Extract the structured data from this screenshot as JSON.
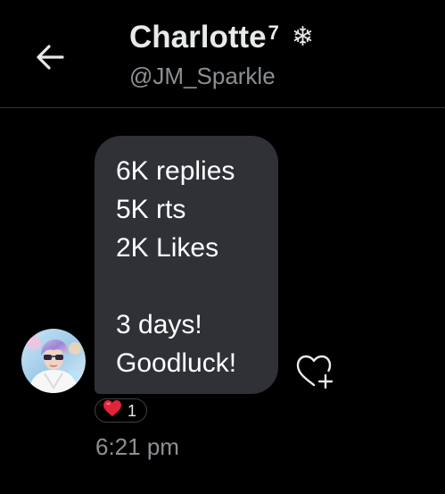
{
  "header": {
    "back_icon": "arrow-left-icon",
    "display_name": "Charlotte",
    "name_superscript": "7",
    "name_emoji": "❄",
    "handle": "@JM_Sparkle"
  },
  "message": {
    "lines": [
      "6K replies",
      "5K rts",
      "2K Likes",
      "3 days!",
      "Goodluck!"
    ],
    "reaction": {
      "icon": "heart-emoji-icon",
      "count": "1"
    },
    "add_reaction_icon": "heart-plus-icon",
    "timestamp": "6:21 pm"
  },
  "colors": {
    "background": "#000000",
    "bubble": "#2f3136",
    "secondary_text": "#8b9095",
    "heart": "#e0243a"
  }
}
